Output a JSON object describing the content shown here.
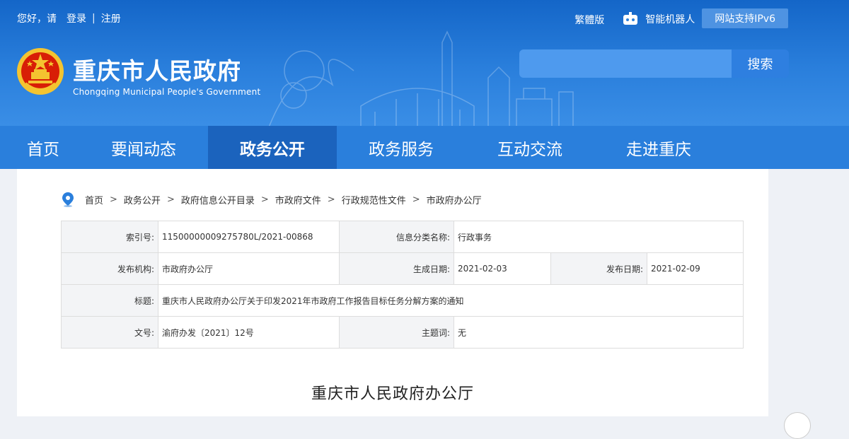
{
  "top": {
    "greeting": "您好，请",
    "login": "登录",
    "divider": "|",
    "register": "注册",
    "traditional": "繁體版",
    "robot": "智能机器人",
    "ipv6": "网站支持IPv6"
  },
  "logo": {
    "title": "重庆市人民政府",
    "subtitle": "Chongqing Municipal People's Government"
  },
  "search": {
    "placeholder": "",
    "button": "搜索"
  },
  "nav": {
    "items": [
      "首页",
      "要闻动态",
      "政务公开",
      "政务服务",
      "互动交流",
      "走进重庆"
    ],
    "active": "政务公开"
  },
  "breadcrumb": {
    "items": [
      "首页",
      "政务公开",
      "政府信息公开目录",
      "市政府文件",
      "行政规范性文件",
      "市政府办公厅"
    ],
    "separator": ">"
  },
  "info": {
    "index_label": "索引号:",
    "index_value": "11500000009275780L/2021-00868",
    "category_label": "信息分类名称:",
    "category_value": "行政事务",
    "org_label": "发布机构:",
    "org_value": "市政府办公厅",
    "created_label": "生成日期:",
    "created_value": "2021-02-03",
    "published_label": "发布日期:",
    "published_value": "2021-02-09",
    "title_label": "标题:",
    "title_value": "重庆市人民政府办公厅关于印发2021年市政府工作报告目标任务分解方案的通知",
    "docno_label": "文号:",
    "docno_value": "渝府办发〔2021〕12号",
    "subject_label": "主题词:",
    "subject_value": "无"
  },
  "doc": {
    "heading": "重庆市人民政府办公厅"
  },
  "colors": {
    "header": "#2a7fdc",
    "nav_active": "#1b63bd",
    "emblem_red": "#d81e06",
    "emblem_gold": "#f4c430"
  }
}
